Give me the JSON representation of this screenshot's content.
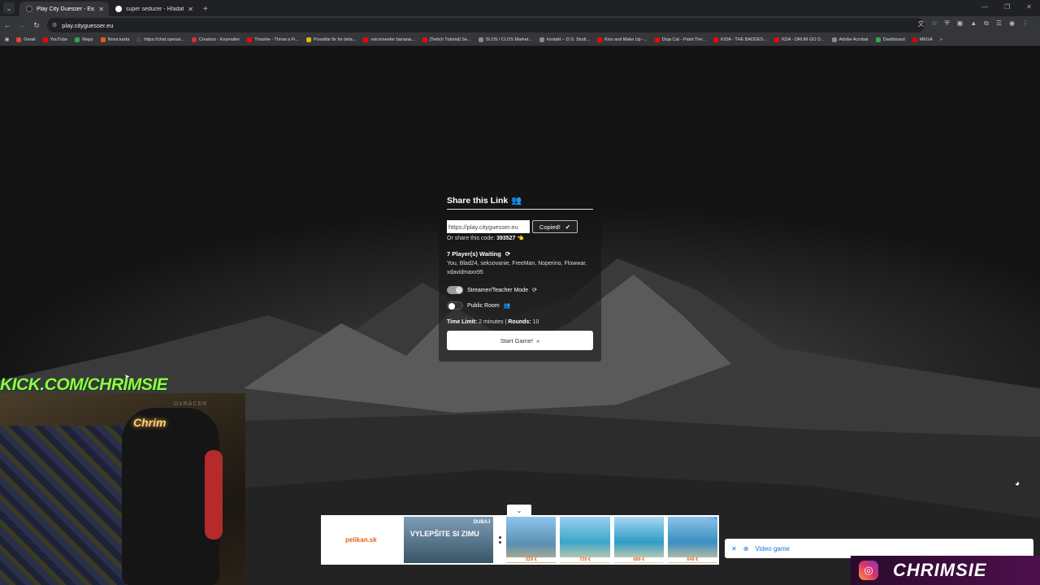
{
  "browser": {
    "tabs": [
      {
        "title": "Play City Guesser - Explore the",
        "active": true
      },
      {
        "title": "super seducer - Hľadať Googl",
        "active": false
      }
    ],
    "url": "play.cityguesser.eu",
    "bookmarks": [
      "Gmail",
      "YouTube",
      "Mapy",
      "Nová karta",
      "https://chat.openai...",
      "Creators - Keymailer",
      "Tinashe - Throw a Fi...",
      "Possible fix for dela...",
      "voicemeeter banana...",
      "[Twitch Tutorial] Se...",
      "SLOS / CLOS Market...",
      "kontakt – D.S. Studi...",
      "Kiss and Make Up -...",
      "Doja Cat - Paint The...",
      "K/DA - THE BADDES...",
      "KDA - DRUM GO D...",
      "Adobe Acrobat",
      "Dashboard",
      "MEGA"
    ]
  },
  "modal": {
    "title": "Share this Link",
    "link_value": "https://play.cityguesser.eu",
    "copy_label": "Copied!",
    "code_prefix": "Or share this code:",
    "code": "393527",
    "players_title": "7 Player(s) Waiting",
    "players_list": "You, Blad24, seksovanie, FreeMan, Noperino, Flowwar, xdavidmaxx95",
    "streamer_label": "Streamer/Teacher Mode",
    "streamer_on": true,
    "public_label": "Public Room",
    "public_on": false,
    "time_label": "Time Limit:",
    "time_value": "2 minutes",
    "rounds_label": "Rounds:",
    "rounds_value": "10",
    "start_label": "Start Game!"
  },
  "overlay": {
    "kick_text": "KICK.COM/CHRIMSIE",
    "neon_text": "Chrim",
    "chair_brand": "DXRACER",
    "channel_name": "CHRIMSIE"
  },
  "ad": {
    "logo": "pelikan.sk",
    "headline": "VYLEPŠITE SI ZIMU",
    "place": "DUBAJ",
    "prices": [
      "529 €",
      "729 €",
      "689 €",
      "649 €"
    ]
  },
  "search": {
    "text": "Video game"
  },
  "colors": {
    "kick_green": "#8dfc4a",
    "accent_orange": "#e85d1a",
    "modal_button": "#ffffff"
  }
}
